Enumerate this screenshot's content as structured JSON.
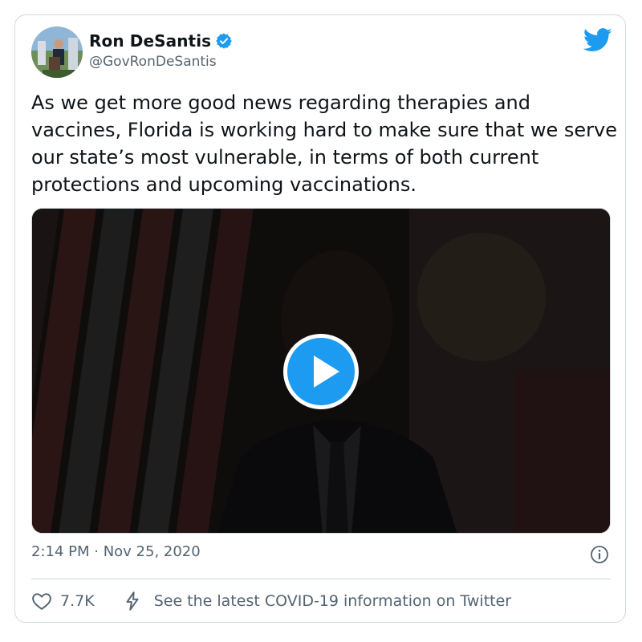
{
  "author": {
    "name": "Ron DeSantis",
    "handle": "@GovRonDeSantis",
    "verified": true
  },
  "tweet": {
    "text": "As we get more good news regarding therapies and vaccines, Florida is working hard to make sure that we serve our state’s most vulnerable, in terms of both current protections and upcoming vaccinations.",
    "timestamp": "2:14 PM · Nov 25, 2020"
  },
  "media": {
    "type": "video"
  },
  "actions": {
    "likes": "7.7K",
    "covid_link": "See the latest COVID-19 information on Twitter"
  },
  "colors": {
    "brand": "#1d9bf0",
    "text": "#0f1419",
    "muted": "#536471",
    "border": "#cfd9de"
  },
  "icons": [
    "twitter-bird-icon",
    "verified-badge-icon",
    "play-icon",
    "info-icon",
    "heart-icon",
    "covid-bolt-icon"
  ]
}
